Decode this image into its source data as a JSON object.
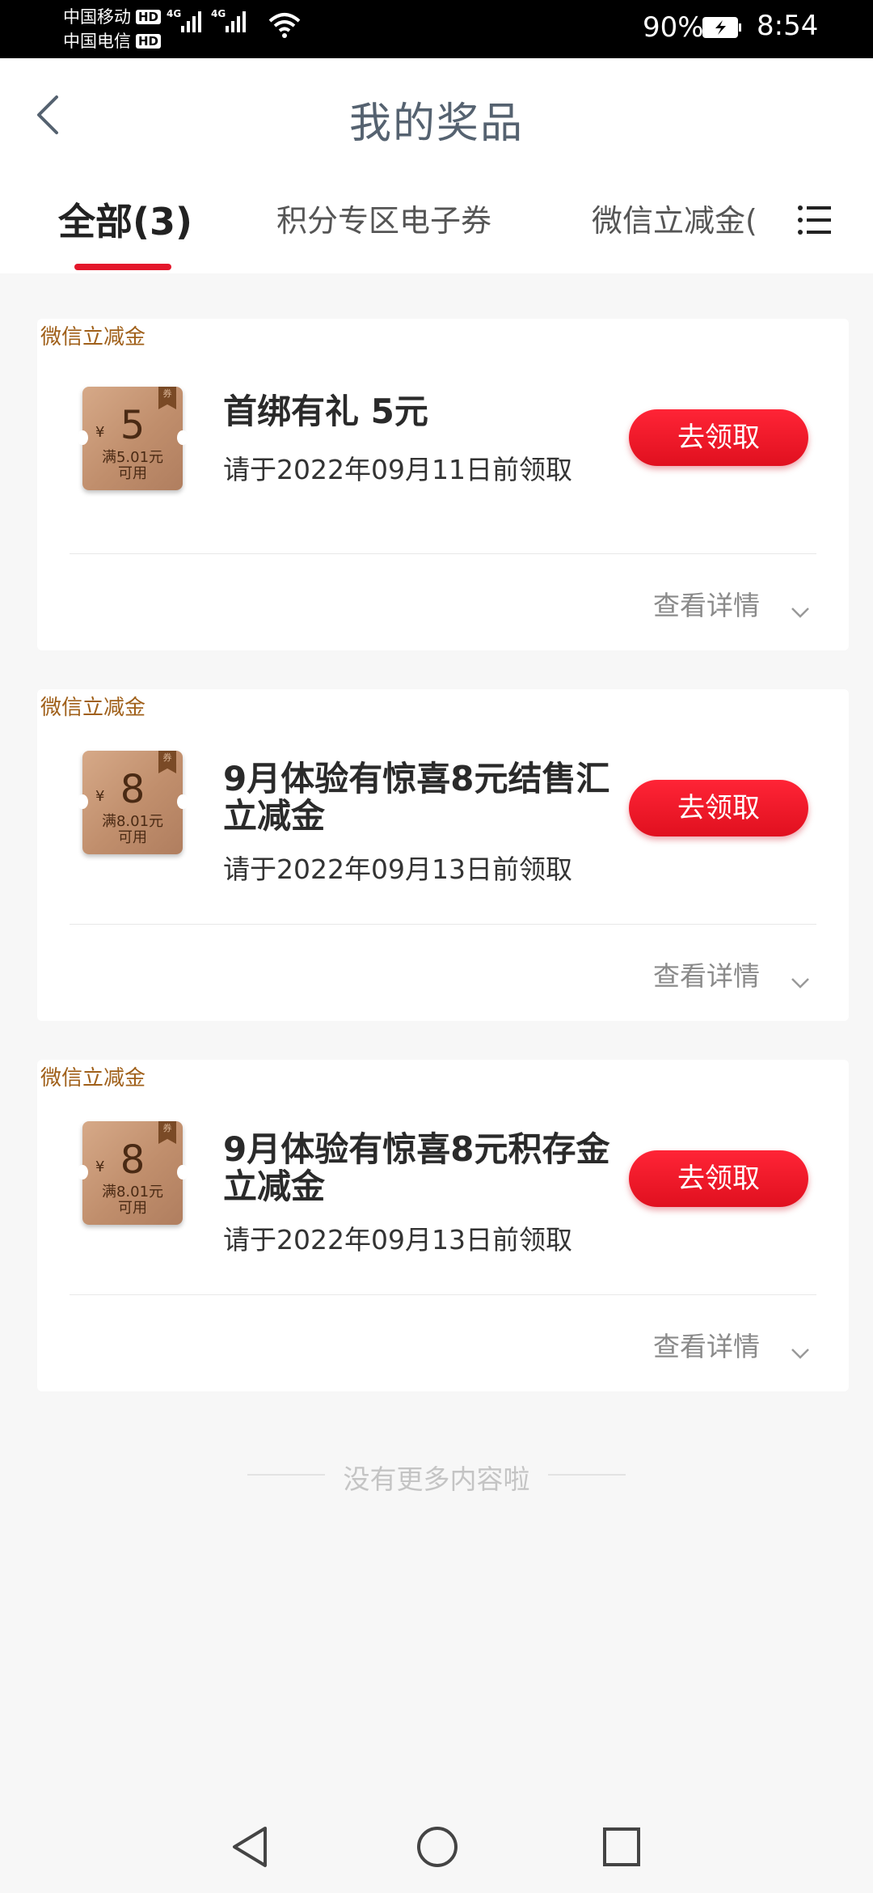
{
  "status_bar": {
    "carrier1": "中国移动",
    "carrier2": "中国电信",
    "hd": "HD",
    "net1": "4G",
    "net2": "4G",
    "battery": "90%",
    "time": "8:54"
  },
  "header": {
    "title": "我的奖品"
  },
  "tabs": {
    "items": [
      "全部(3)",
      "积分专区电子券",
      "微信立减金("
    ]
  },
  "cards": [
    {
      "tag": "微信立减金",
      "coupon_ribbon": "券",
      "coupon_currency": "¥",
      "coupon_amount": "5",
      "coupon_condition": "满5.01元",
      "coupon_available": "可用",
      "title": "首绑有礼 5元",
      "deadline": "请于2022年09月11日前领取",
      "button": "去领取",
      "details": "查看详情"
    },
    {
      "tag": "微信立减金",
      "coupon_ribbon": "券",
      "coupon_currency": "¥",
      "coupon_amount": "8",
      "coupon_condition": "满8.01元",
      "coupon_available": "可用",
      "title": "9月体验有惊喜8元结售汇立减金",
      "deadline": "请于2022年09月13日前领取",
      "button": "去领取",
      "details": "查看详情"
    },
    {
      "tag": "微信立减金",
      "coupon_ribbon": "券",
      "coupon_currency": "¥",
      "coupon_amount": "8",
      "coupon_condition": "满8.01元",
      "coupon_available": "可用",
      "title": "9月体验有惊喜8元积存金立减金",
      "deadline": "请于2022年09月13日前领取",
      "button": "去领取",
      "details": "查看详情"
    }
  ],
  "footer": {
    "no_more": "没有更多内容啦"
  },
  "colors": {
    "accent": "#e4172b",
    "tag": "#a0601a",
    "coupon": "#c69a79"
  }
}
